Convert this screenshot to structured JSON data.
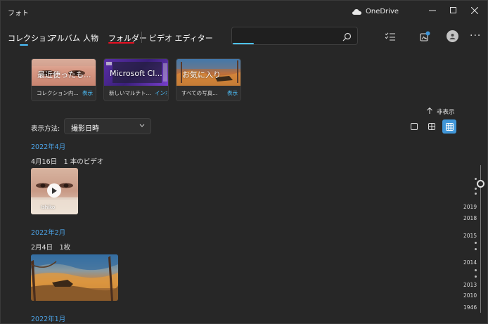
{
  "window": {
    "title": "フォト",
    "onedrive_label": "OneDrive",
    "controls": {
      "minimize": "—",
      "maximize": "☐",
      "close": "✕"
    }
  },
  "nav": {
    "tabs": [
      {
        "label": "コレクション",
        "selected": true
      },
      {
        "label": "アルバム"
      },
      {
        "label": "人物"
      },
      {
        "label": "フォルダー"
      },
      {
        "label": "ビデオ エディター"
      }
    ],
    "selected_color": "#4cc2ff",
    "highlight_color": "#e81123",
    "search_placeholder": "",
    "more_label": "···"
  },
  "album_cards": [
    {
      "thumb_title": "最近使ったも...",
      "caption": "コレクション内...",
      "link": "表示"
    },
    {
      "thumb_title": "Microsoft Cl...",
      "caption": "新しいマルチト...",
      "link": "インポート"
    },
    {
      "thumb_title": "お気に入り",
      "caption": "すべての写真...",
      "link": "表示"
    }
  ],
  "hide_toggle": {
    "icon": "arrow-up-icon",
    "label": "非表示"
  },
  "view": {
    "label": "表示方法:",
    "selected": "撮影日時"
  },
  "timeline": [
    {
      "month": "2022年4月",
      "day": "4月16日　1 本のビデオ",
      "thumb_caption": "Ishiko"
    },
    {
      "month": "2022年2月",
      "day": "2月4日　1枚"
    },
    {
      "month": "2022年1月"
    }
  ],
  "scrubber_years": [
    "2019",
    "2018",
    "2015",
    "2014",
    "2013",
    "2010",
    "1946"
  ],
  "colors": {
    "accent": "#4cc2ff",
    "link": "#4ca3e6",
    "background": "#272727"
  }
}
